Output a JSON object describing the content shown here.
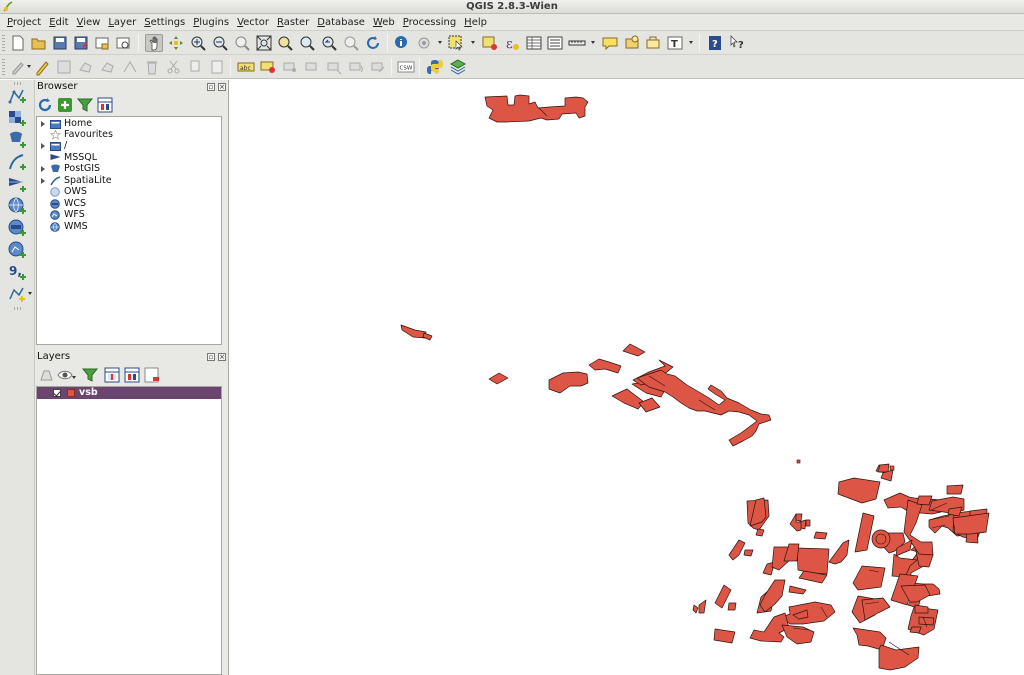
{
  "window": {
    "title": "QGIS 2.8.3-Wien"
  },
  "menubar": {
    "items": [
      "Project",
      "Edit",
      "View",
      "Layer",
      "Settings",
      "Plugins",
      "Vector",
      "Raster",
      "Database",
      "Web",
      "Processing",
      "Help"
    ]
  },
  "toolbar_label": {
    "csw": "CSW",
    "abc": "abc"
  },
  "browser": {
    "title": "Browser",
    "items": [
      {
        "label": "Home",
        "icon": "folder-icon",
        "expandable": true
      },
      {
        "label": "Favourites",
        "icon": "star-icon",
        "expandable": false
      },
      {
        "label": "/",
        "icon": "folder-icon",
        "expandable": true
      },
      {
        "label": "MSSQL",
        "icon": "mssql-icon",
        "expandable": false
      },
      {
        "label": "PostGIS",
        "icon": "postgis-icon",
        "expandable": true
      },
      {
        "label": "SpatiaLite",
        "icon": "spatialite-icon",
        "expandable": true
      },
      {
        "label": "OWS",
        "icon": "ows-icon",
        "expandable": false
      },
      {
        "label": "WCS",
        "icon": "wcs-icon",
        "expandable": false
      },
      {
        "label": "WFS",
        "icon": "wfs-icon",
        "expandable": false
      },
      {
        "label": "WMS",
        "icon": "wms-icon",
        "expandable": false
      }
    ]
  },
  "layers": {
    "title": "Layers",
    "items": [
      {
        "name": "vsb",
        "visible": true,
        "fill_color": "#dd5544"
      }
    ]
  },
  "colors": {
    "feature_fill": "#dd5544",
    "feature_stroke": "#2a1410",
    "selected_layer_bg": "#6b4470"
  }
}
